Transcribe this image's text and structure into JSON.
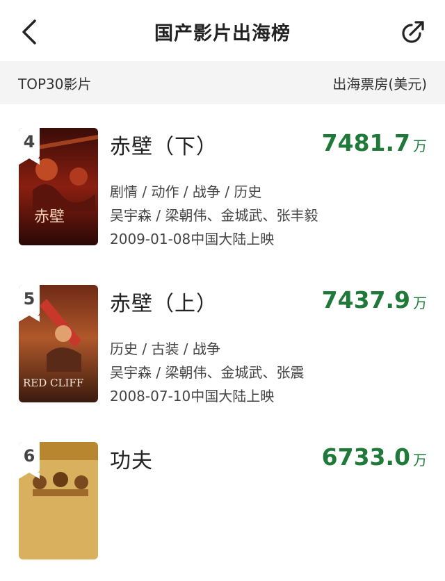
{
  "header": {
    "title": "国产影片出海榜",
    "back_icon": "chevron-left-icon",
    "share_icon": "share-icon"
  },
  "subheader": {
    "left_label": "TOP30影片",
    "right_label": "出海票房(美元)"
  },
  "colors": {
    "accent_green": "#1f7a3a",
    "subheader_bg": "#f4f4f4"
  },
  "movies": [
    {
      "rank": "4",
      "title": "赤壁（下）",
      "box_office": "7481.7",
      "unit": "万",
      "genres": "剧情 / 动作 / 战争 / 历史",
      "cast": "吴宇森 / 梁朝伟、金城武、张丰毅",
      "release": "2009-01-08中国大陆上映",
      "poster_text": "赤壁"
    },
    {
      "rank": "5",
      "title": "赤壁（上）",
      "box_office": "7437.9",
      "unit": "万",
      "genres": "历史 / 古装 / 战争",
      "cast": "吴宇森 / 梁朝伟、金城武、张震",
      "release": "2008-07-10中国大陆上映",
      "poster_text": "RED CLIFF"
    },
    {
      "rank": "6",
      "title": "功夫",
      "box_office": "6733.0",
      "unit": "万",
      "genres": "",
      "cast": "",
      "release": "",
      "poster_text": ""
    }
  ]
}
